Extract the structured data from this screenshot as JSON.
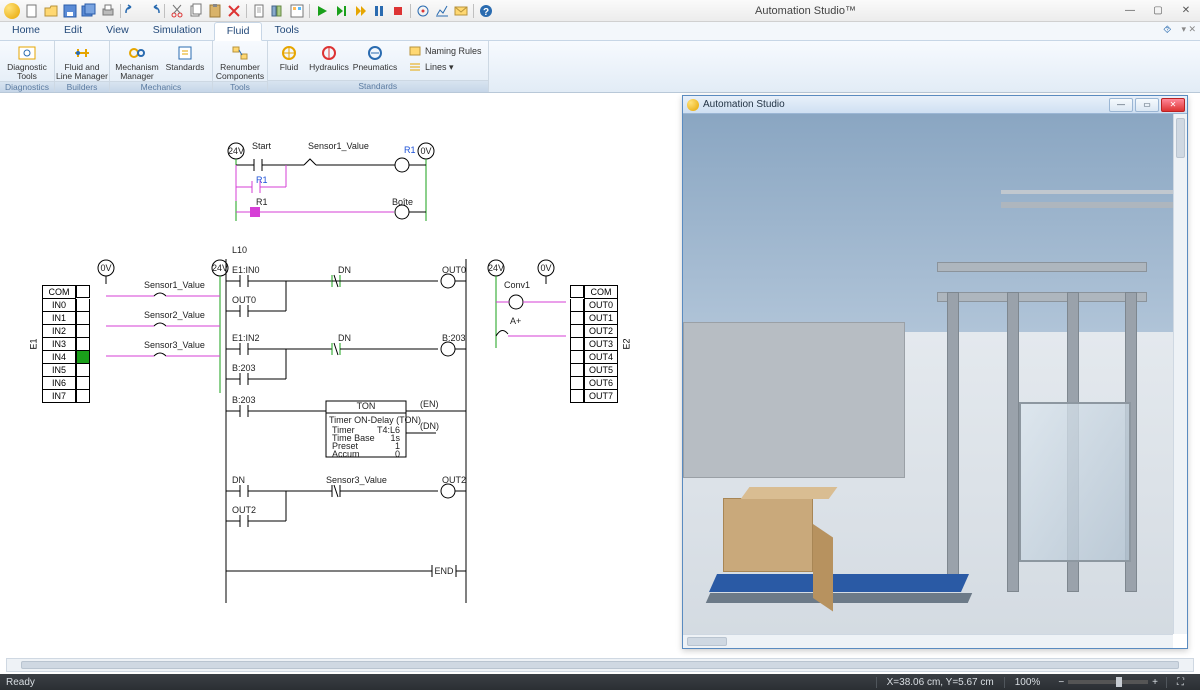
{
  "app": {
    "title": "Automation Studio™"
  },
  "menus": [
    "Home",
    "Edit",
    "View",
    "Simulation",
    "Fluid",
    "Tools"
  ],
  "active_menu": "Fluid",
  "ribbon": {
    "groups": [
      {
        "label": "Diagnostics",
        "items": [
          {
            "big": "Diagnostic\nTools"
          }
        ]
      },
      {
        "label": "Builders",
        "items": [
          {
            "big": "Fluid and\nLine Manager"
          }
        ]
      },
      {
        "label": "Mechanics",
        "items": [
          {
            "big": "Mechanism\nManager"
          },
          {
            "big": "Standards"
          }
        ]
      },
      {
        "label": "Tools",
        "items": [
          {
            "big": "Renumber\nComponents"
          }
        ]
      },
      {
        "label": "Standards",
        "items": [
          {
            "big": "Fluid"
          },
          {
            "big": "Hydraulics"
          },
          {
            "big": "Pneumatics"
          }
        ],
        "small": [
          {
            "t": "Naming Rules"
          },
          {
            "t": "Lines ▾"
          }
        ]
      }
    ]
  },
  "child_window": {
    "title": "Automation Studio"
  },
  "status": {
    "ready": "Ready",
    "coords": "X=38.06 cm, Y=5.67 cm",
    "zoom": "100%"
  },
  "schem": {
    "top": {
      "v24": "24V",
      "v0": "0V",
      "start": "Start",
      "sensor1": "Sensor1_Value",
      "R1": "R1",
      "boite": "Boîte"
    },
    "inputs": {
      "side": "E1",
      "header": "COM",
      "rows": [
        "IN0",
        "IN1",
        "IN2",
        "IN3",
        "IN4",
        "IN5",
        "IN6",
        "IN7"
      ],
      "v0": "0V",
      "v24": "24V",
      "sensors": [
        "Sensor1_Value",
        "Sensor2_Value",
        "Sensor3_Value"
      ]
    },
    "outputs": {
      "side": "E2",
      "header": "COM",
      "rows": [
        "OUT0",
        "OUT1",
        "OUT2",
        "OUT3",
        "OUT4",
        "OUT5",
        "OUT6",
        "OUT7"
      ],
      "v24": "24V",
      "v0": "0V",
      "conv": "Conv1",
      "aplus": "A+"
    },
    "ladder": {
      "title": "L10",
      "r1": {
        "ein": "E1:IN0",
        "dn": "DN",
        "out": "OUT0"
      },
      "r2": {
        "out0": "OUT0"
      },
      "r3": {
        "ein": "E1:IN2",
        "dn": "DN",
        "b": "B:203"
      },
      "r4": {
        "b": "B:203"
      },
      "r5": {
        "b": "B:203",
        "ton_title": "TON",
        "ton_name": "Timer ON-Delay (TON)",
        "rows": [
          [
            "Timer",
            "T4:L6"
          ],
          [
            "Time Base",
            "1s"
          ],
          [
            "Preset",
            "1"
          ],
          [
            "Accum",
            "0"
          ]
        ]
      },
      "r6": {
        "dn": "DN",
        "s3": "Sensor3_Value",
        "out": "OUT2"
      },
      "r7": {
        "out2": "OUT2"
      },
      "end": "END"
    }
  }
}
